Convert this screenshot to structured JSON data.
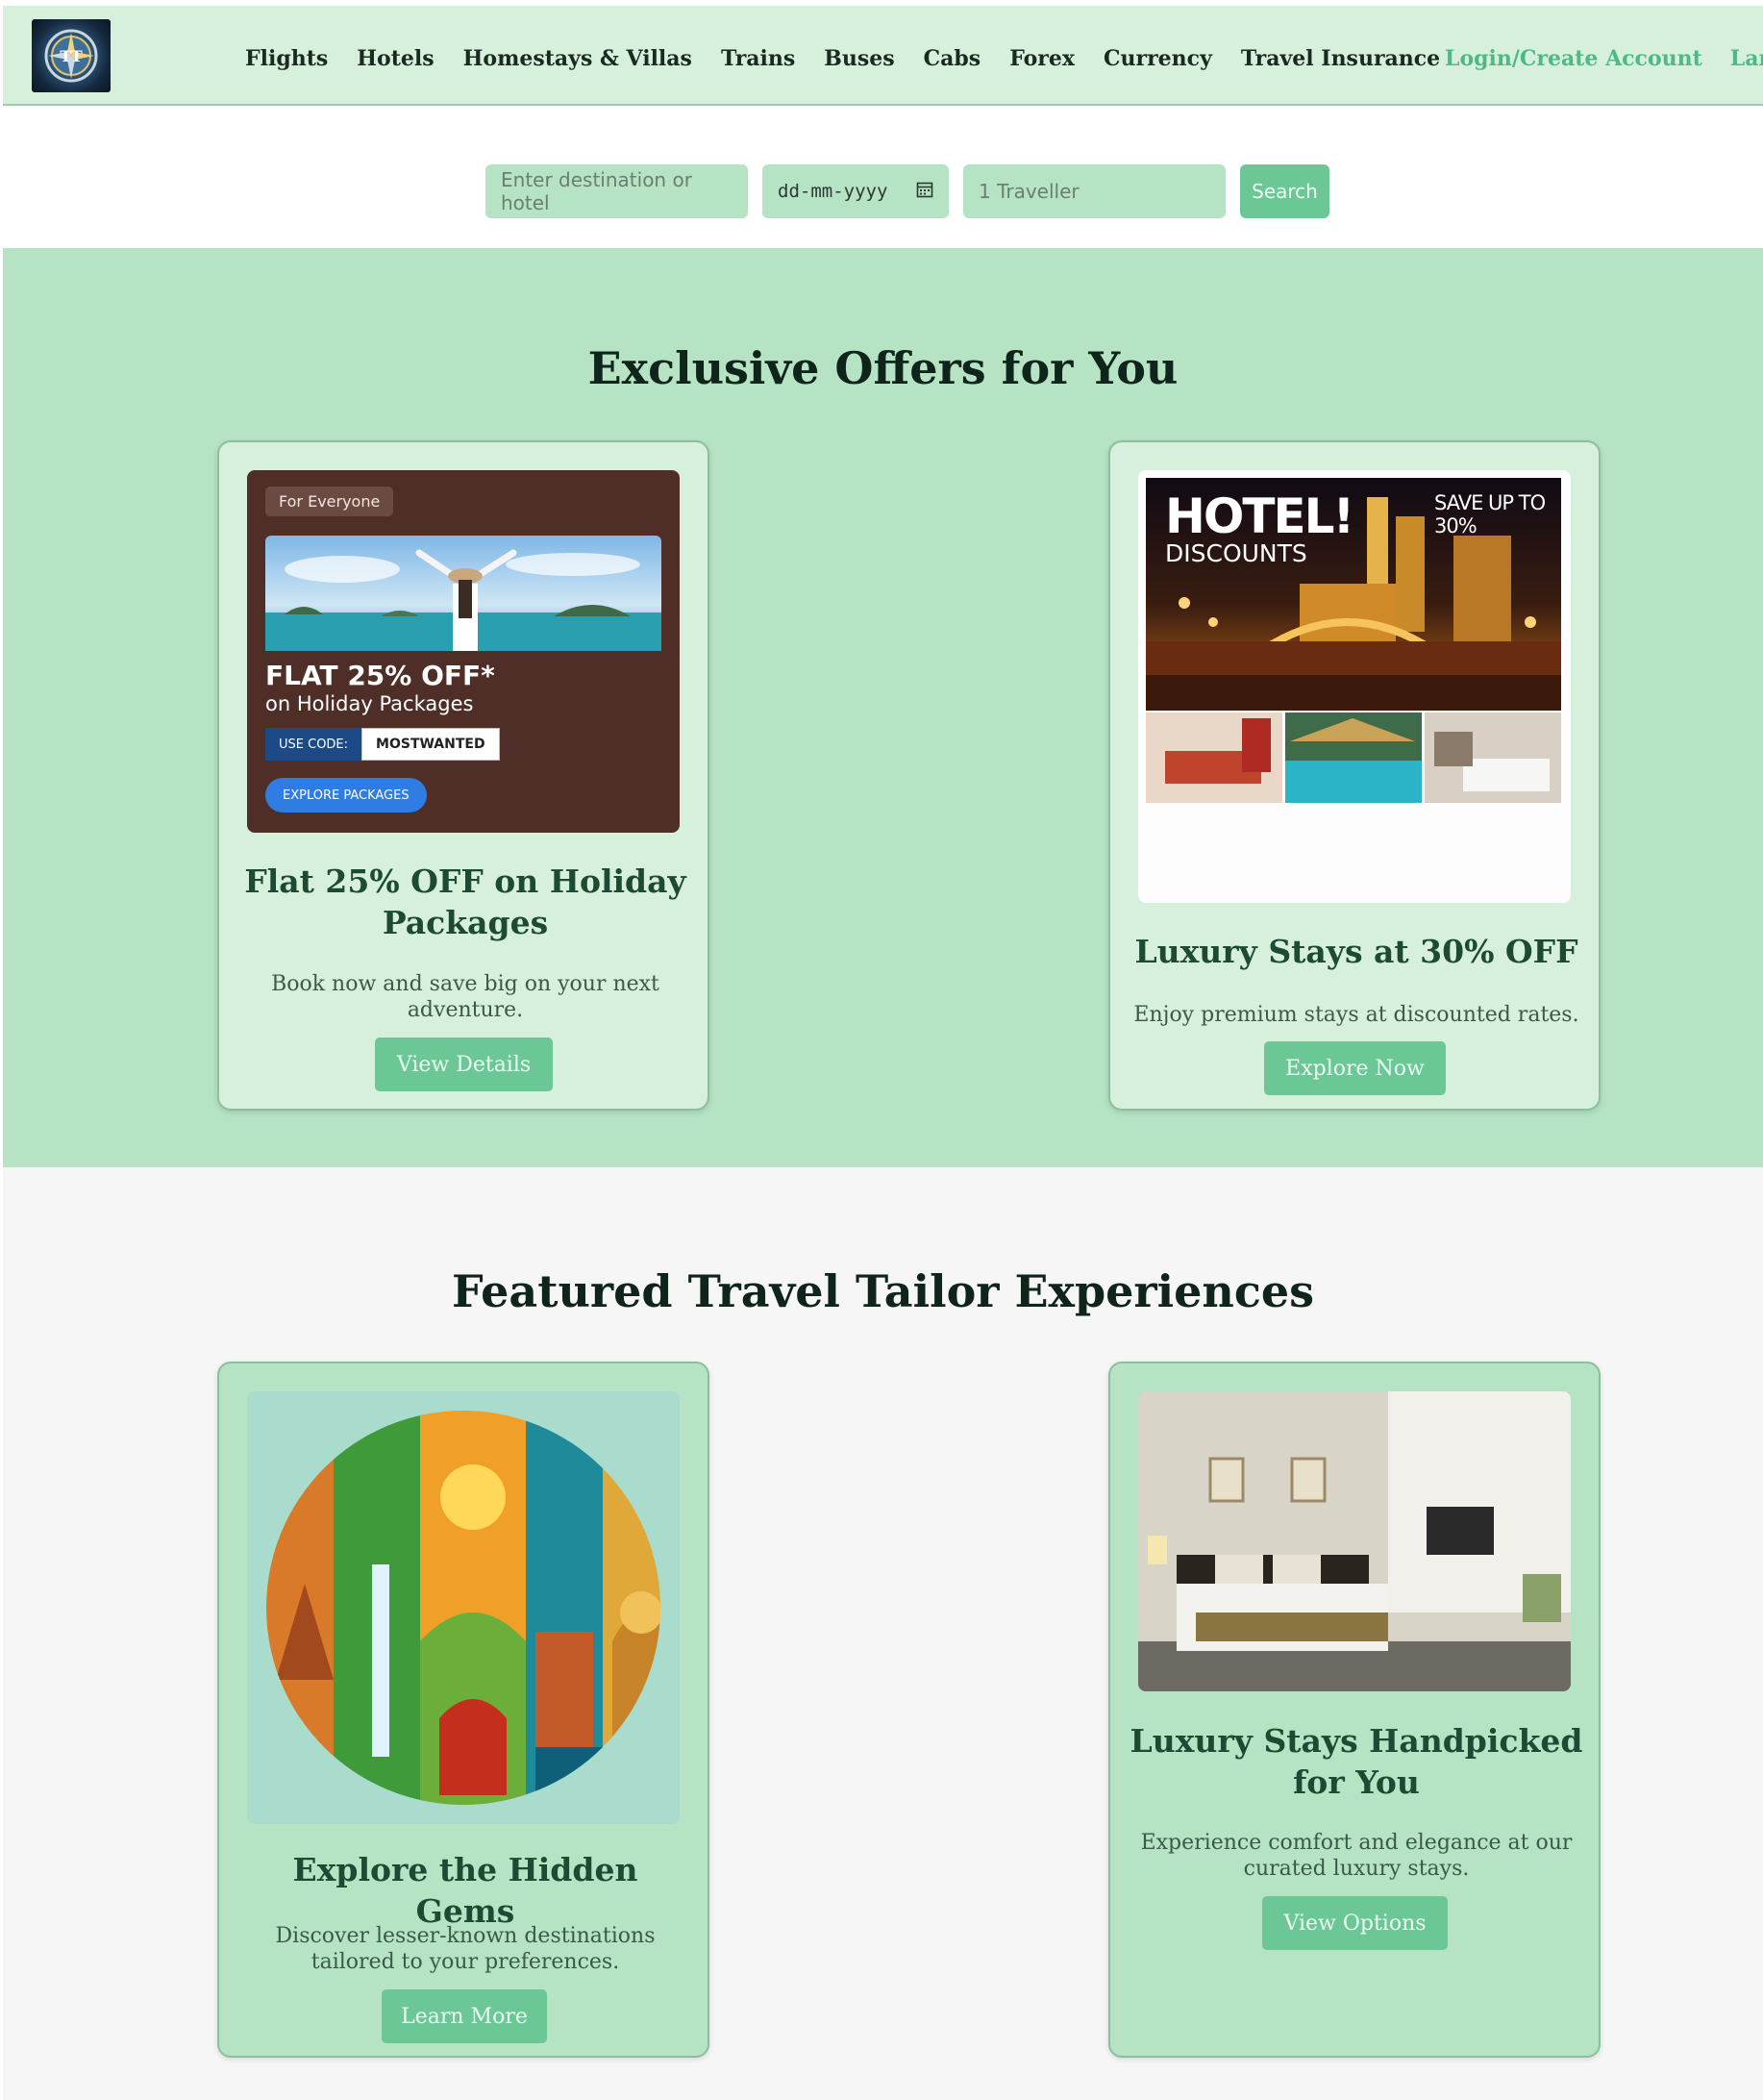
{
  "header": {
    "logo_alt": "TT",
    "nav": [
      "Flights",
      "Hotels",
      "Homestays & Villas",
      "Trains",
      "Buses",
      "Cabs",
      "Forex",
      "Currency",
      "Travel Insurance"
    ],
    "login": "Login/Create Account",
    "language": "Langua"
  },
  "search": {
    "destination_placeholder": "Enter destination or hotel",
    "date_placeholder": "dd-mm-yyyy",
    "travellers": "1 Traveller",
    "button": "Search"
  },
  "offers": {
    "title": "Exclusive Offers for You",
    "cards": [
      {
        "banner": {
          "tag": "For Everyone",
          "headline": "FLAT 25% OFF*",
          "subline": "on Holiday Packages",
          "code_label": "USE CODE:",
          "code": "MOSTWANTED",
          "cta": "EXPLORE PACKAGES"
        },
        "title": "Flat 25% OFF on Holiday Packages",
        "description": "Book now and save big on your next adventure.",
        "button": "View Details"
      },
      {
        "banner": {
          "headline": "HOTEL!",
          "subline": "DISCOUNTS",
          "save": "SAVE UP TO 30%"
        },
        "title": "Luxury Stays at 30% OFF",
        "description": "Enjoy premium stays at discounted rates.",
        "button": "Explore Now"
      }
    ]
  },
  "featured": {
    "title": "Featured Travel Tailor Experiences",
    "cards": [
      {
        "title": "Explore the Hidden Gems",
        "description": "Discover lesser-known destinations tailored to your preferences.",
        "button": "Learn More"
      },
      {
        "title": "Luxury Stays Handpicked for You",
        "description": "Experience comfort and elegance at our curated luxury stays.",
        "button": "View Options"
      }
    ]
  },
  "colors": {
    "header_bg": "#d6f0dc",
    "section_bg": "#b5e3c4",
    "button_bg": "#6cc797",
    "accent_link": "#4fb986"
  }
}
